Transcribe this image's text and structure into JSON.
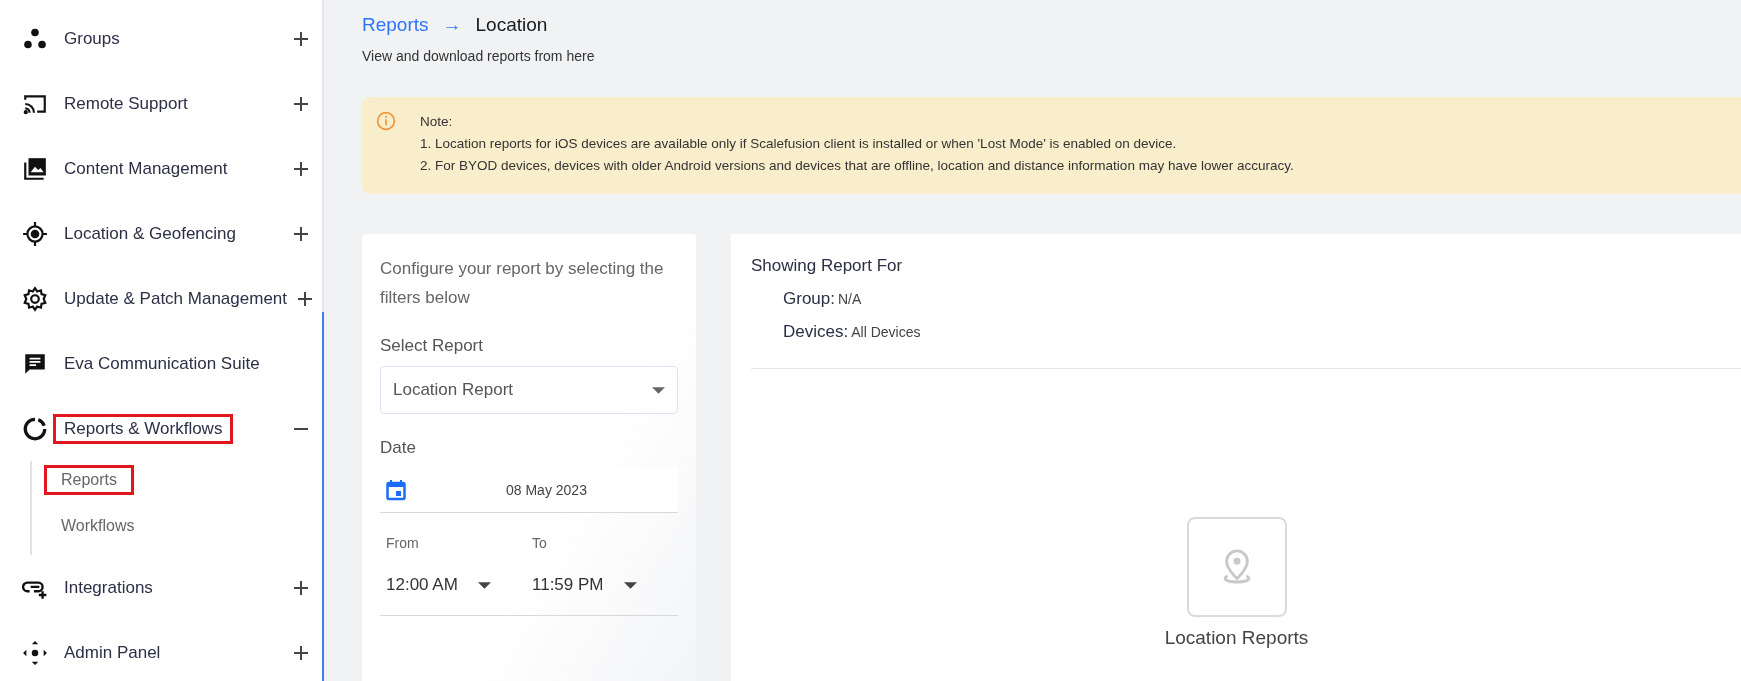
{
  "sidebar": {
    "items": [
      {
        "label": "Groups",
        "expanded": false,
        "outlined": false
      },
      {
        "label": "Remote Support",
        "expanded": false,
        "outlined": false
      },
      {
        "label": "Content Management",
        "expanded": false,
        "outlined": false
      },
      {
        "label": "Location & Geofencing",
        "expanded": false,
        "outlined": false
      },
      {
        "label": "Update & Patch Management",
        "expanded": false,
        "outlined": false
      },
      {
        "label": "Eva Communication Suite",
        "outlined": false
      },
      {
        "label": "Reports & Workflows",
        "expanded": true,
        "outlined": true,
        "children": [
          {
            "label": "Reports",
            "outlined": true
          },
          {
            "label": "Workflows",
            "outlined": false
          }
        ]
      },
      {
        "label": "Integrations",
        "expanded": false,
        "outlined": false
      },
      {
        "label": "Admin Panel",
        "expanded": false,
        "outlined": false
      }
    ]
  },
  "breadcrumb": {
    "parent": "Reports",
    "arrow": "→",
    "current": "Location"
  },
  "subtitle": "View and download reports from here",
  "note": {
    "title": "Note:",
    "lines": [
      "1. Location reports for iOS devices are available only if Scalefusion client is installed or when 'Lost Mode' is enabled on device.",
      "2. For BYOD devices, devices with older Android versions and devices that are offline, location and distance information may have lower accuracy."
    ]
  },
  "filters": {
    "intro": "Configure your report by selecting the filters below",
    "report_label": "Select Report",
    "report_value": "Location Report",
    "date_label": "Date",
    "date_value": "08 May 2023",
    "from_label": "From",
    "from_value": "12:00 AM",
    "to_label": "To",
    "to_value": "11:59 PM"
  },
  "report": {
    "heading": "Showing Report For",
    "fields": [
      {
        "label": "Group:",
        "value": "N/A"
      },
      {
        "label": "Devices:",
        "value": "All Devices"
      }
    ],
    "empty_title": "Location Reports"
  }
}
